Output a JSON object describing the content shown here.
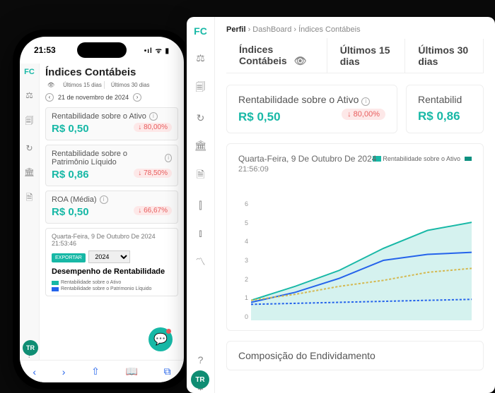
{
  "phone": {
    "clock": "21:53",
    "title": "Índices Contábeis",
    "tabs": {
      "t1": "Últimos 15 dias",
      "t2": "Últimos 30 dias"
    },
    "date": "21 de novembro de 2024",
    "metrics": [
      {
        "title": "Rentabilidade sobre o Ativo",
        "value": "R$ 0,50",
        "delta": "↓ 80,00%"
      },
      {
        "title": "Rentabilidade sobre o Patrimônio Líquido",
        "value": "R$ 0,86",
        "delta": "↓ 78,50%"
      },
      {
        "title": "ROA (Média)",
        "value": "R$ 0,50",
        "delta": "↓ 66,67%"
      }
    ],
    "chart_date": "Quarta-Feira, 9 De Outubro De 2024",
    "chart_time": "21:53:46",
    "export_label": "EXPORTAR",
    "year": "2024",
    "perf_title": "Desempenho de Rentabilidade",
    "legend": {
      "a": "Rentabilidade sobre o Ativo",
      "b": "Rentabilidade sobre o Patrimonio Líquido"
    },
    "avatar": "TR"
  },
  "desktop": {
    "breadcrumb": {
      "a": "Perfil",
      "b": "DashBoard",
      "c": "Índices Contábeis"
    },
    "page_title": "Índices Contábeis",
    "tabs": {
      "t1": "Últimos 15 dias",
      "t2": "Últimos 30 dias"
    },
    "cards": [
      {
        "title": "Rentabilidade sobre o Ativo",
        "value": "R$ 0,50",
        "delta": "↓ 80,00%"
      },
      {
        "title": "Rentabilid",
        "value": "R$ 0,86",
        "delta": ""
      }
    ],
    "chart": {
      "date": "Quarta-Feira, 9 De Outubro De 2024",
      "time": "21:56:09",
      "legend": {
        "a": "Rentabilidade sobre o Ativo"
      }
    },
    "compo_title": "Composição do Endividamento",
    "avatar": "TR"
  },
  "chart_data": {
    "type": "line",
    "ylim": [
      0,
      6
    ],
    "y_ticks": [
      0,
      1,
      2,
      3,
      4,
      5,
      6
    ],
    "x": [
      0,
      1,
      2,
      3,
      4,
      5
    ],
    "series": [
      {
        "name": "Rentabilidade sobre o Ativo (area)",
        "color": "#17b8a6",
        "values": [
          1.0,
          1.7,
          2.5,
          3.6,
          4.5,
          4.9
        ]
      },
      {
        "name": "Série azul",
        "color": "#2463eb",
        "values": [
          0.9,
          1.4,
          2.1,
          3.0,
          3.3,
          3.4
        ]
      },
      {
        "name": "Série tracejada amarela",
        "color": "#d4b850",
        "values": [
          1.0,
          1.3,
          1.7,
          2.0,
          2.4,
          2.6
        ]
      },
      {
        "name": "Série tracejada azul",
        "color": "#2463eb",
        "values": [
          0.8,
          0.85,
          0.9,
          0.95,
          1.0,
          1.05
        ]
      }
    ]
  }
}
